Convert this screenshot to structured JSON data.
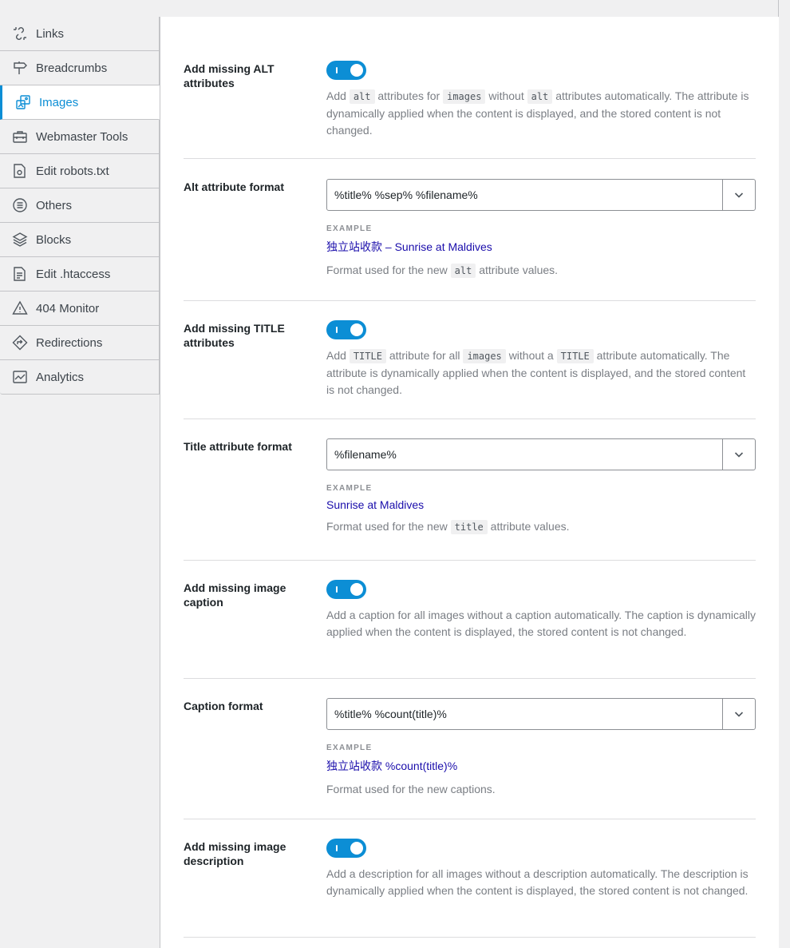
{
  "sidebar": {
    "items": [
      {
        "label": "Links",
        "icon": "link-icon"
      },
      {
        "label": "Breadcrumbs",
        "icon": "signpost-icon"
      },
      {
        "label": "Images",
        "icon": "images-icon",
        "active": true
      },
      {
        "label": "Webmaster Tools",
        "icon": "toolbox-icon"
      },
      {
        "label": "Edit robots.txt",
        "icon": "robots-file-icon"
      },
      {
        "label": "Others",
        "icon": "list-circle-icon"
      },
      {
        "label": "Blocks",
        "icon": "blocks-icon"
      },
      {
        "label": "Edit .htaccess",
        "icon": "htaccess-file-icon"
      },
      {
        "label": "404 Monitor",
        "icon": "warning-icon"
      },
      {
        "label": "Redirections",
        "icon": "redirect-icon"
      },
      {
        "label": "Analytics",
        "icon": "analytics-icon"
      }
    ]
  },
  "settings": {
    "alt_toggle": {
      "label": "Add missing ALT attributes",
      "enabled": true,
      "desc_1": "Add",
      "code_1": "alt",
      "desc_2": "attributes for",
      "code_2": "images",
      "desc_3": "without",
      "code_3": "alt",
      "desc_4": "attributes automatically. The attribute is dynamically applied when the content is displayed, and the stored content is not changed."
    },
    "alt_format": {
      "label": "Alt attribute format",
      "value": "%title% %sep% %filename%",
      "example_label": "EXAMPLE",
      "example_value": "独立站收款 – Sunrise at Maldives",
      "desc_1": "Format used for the new",
      "code_1": "alt",
      "desc_2": "attribute values."
    },
    "title_toggle": {
      "label": "Add missing TITLE attributes",
      "enabled": true,
      "desc_1": "Add",
      "code_1": "TITLE",
      "desc_2": "attribute for all",
      "code_2": "images",
      "desc_3": "without a",
      "code_3": "TITLE",
      "desc_4": "attribute automatically. The attribute is dynamically applied when the content is displayed, and the stored content is not changed."
    },
    "title_format": {
      "label": "Title attribute format",
      "value": "%filename%",
      "example_label": "EXAMPLE",
      "example_value": "Sunrise at Maldives",
      "desc_1": "Format used for the new",
      "code_1": "title",
      "desc_2": "attribute values."
    },
    "caption_toggle": {
      "label": "Add missing image caption",
      "enabled": true,
      "desc": "Add a caption for all images without a caption automatically. The caption is dynamically applied when the content is displayed, the stored content is not changed."
    },
    "caption_format": {
      "label": "Caption format",
      "value": "%title% %count(title)%",
      "example_label": "EXAMPLE",
      "example_value": "独立站收款 %count(title)%",
      "desc": "Format used for the new captions."
    },
    "description_toggle": {
      "label": "Add missing image description",
      "enabled": true,
      "desc": "Add a description for all images without a description automatically. The description is dynamically applied when the content is displayed, the stored content is not changed."
    }
  },
  "colors": {
    "accent": "#0c8ed5",
    "example_link": "#1a0dab"
  }
}
